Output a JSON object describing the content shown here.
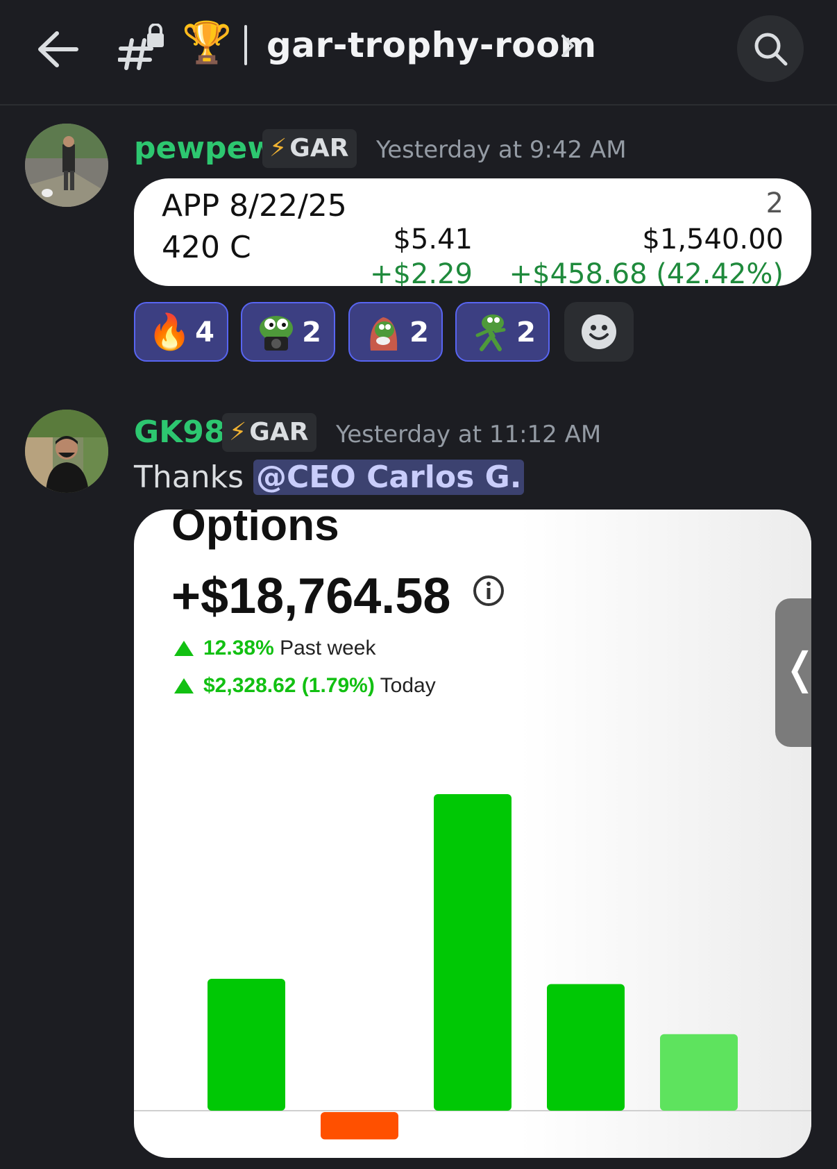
{
  "header": {
    "channel_emoji": "🏆",
    "channel_name": "gar-trophy-room",
    "icons": [
      "back-arrow-icon",
      "locked-hash-icon",
      "chevron-right-icon",
      "search-icon"
    ]
  },
  "messages": [
    {
      "username": "pewpew",
      "badge": "GAR",
      "timestamp": "Yesterday at 9:42 AM",
      "trade_card": {
        "symbol_line": "APP 8/22/25",
        "strike_line": "420 C",
        "quantity": "2",
        "price": "$5.41",
        "price_change": "+$2.29",
        "total_value": "$1,540.00",
        "total_change": "+$458.68 (42.42%)"
      },
      "reactions": [
        {
          "emoji": "fire-emoji",
          "glyph": "🔥",
          "count": "4"
        },
        {
          "emoji": "pepe-camera-emoji",
          "count": "2"
        },
        {
          "emoji": "pepe-hoodie-emoji",
          "count": "2"
        },
        {
          "emoji": "pepe-running-emoji",
          "count": "2"
        }
      ]
    },
    {
      "username": "GK98",
      "badge": "GAR",
      "timestamp": "Yesterday at 11:12 AM",
      "text": "Thanks ",
      "mention": "@CEO Carlos G.",
      "attachment": {
        "title": "Options",
        "total": "+$18,764.58",
        "week_change": "12.38%",
        "week_label": "Past week",
        "today_change": "$2,328.62 (1.79%)",
        "today_label": "Today",
        "colors": {
          "up": "#00c805",
          "up_light": "#5ee35e",
          "down": "#ff5000"
        }
      }
    }
  ],
  "chart_data": {
    "type": "bar",
    "title": "Options",
    "categories": [
      "",
      "",
      "",
      "",
      ""
    ],
    "values": [
      100,
      -20,
      240,
      96,
      58
    ],
    "colors": [
      "#00c805",
      "#ff5000",
      "#00c805",
      "#00c805",
      "#5ee35e"
    ],
    "ylim": [
      -30,
      260
    ],
    "grid": false
  }
}
